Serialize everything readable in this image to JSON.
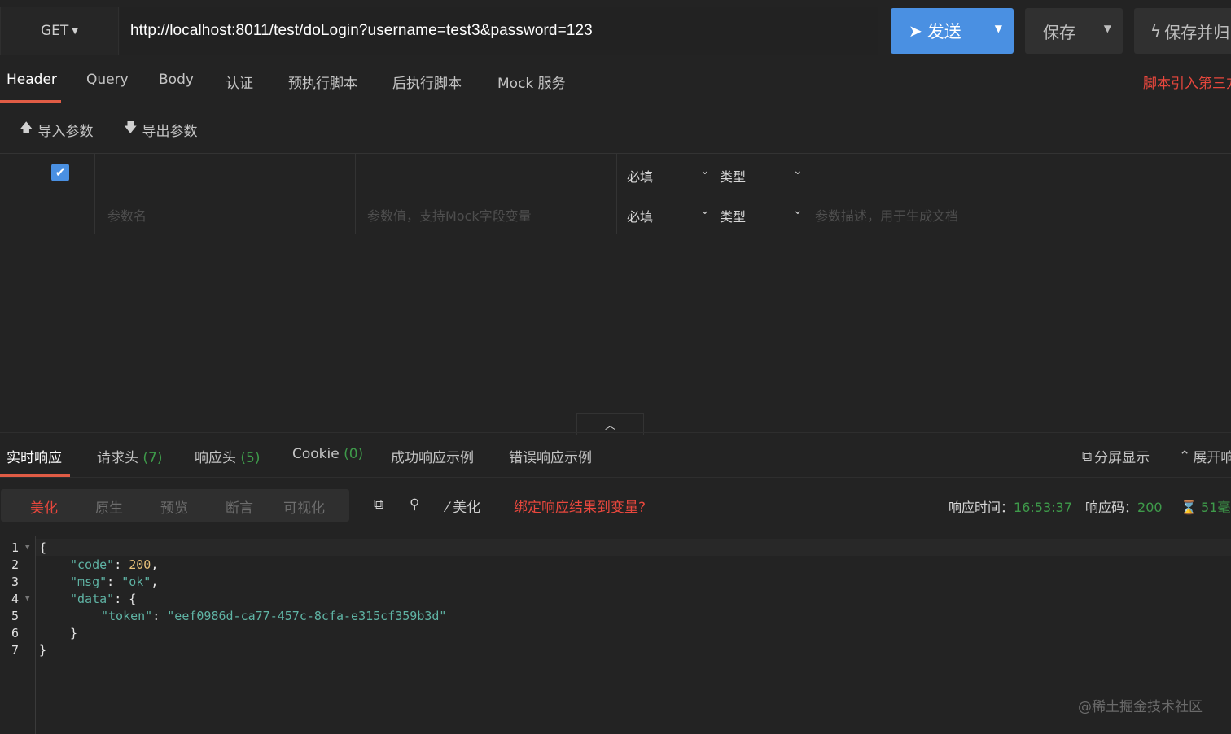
{
  "request": {
    "method": "GET",
    "url": "http://localhost:8011/test/doLogin?username=test3&password=123",
    "send_label": "发送",
    "save_label": "保存",
    "save_return_label": "保存并归"
  },
  "request_tabs": [
    "Header",
    "Query",
    "Body",
    "认证",
    "预执行脚本",
    "后执行脚本",
    "Mock 服务"
  ],
  "script_link": "脚本引入第三方",
  "io": {
    "import": "导入参数",
    "export": "导出参数"
  },
  "params": {
    "row1": {
      "required": "必填",
      "type": "类型"
    },
    "row2": {
      "name_placeholder": "参数名",
      "value_placeholder": "参数值，支持Mock字段变量",
      "required": "必填",
      "type": "类型",
      "desc_placeholder": "参数描述，用于生成文档"
    }
  },
  "response_tabs": [
    {
      "label": "实时响应",
      "count": ""
    },
    {
      "label": "请求头",
      "count": "(7)"
    },
    {
      "label": "响应头",
      "count": "(5)"
    },
    {
      "label": "Cookie",
      "count": "(0)"
    },
    {
      "label": "成功响应示例",
      "count": ""
    },
    {
      "label": "错误响应示例",
      "count": ""
    }
  ],
  "response_right": {
    "split": "分屏显示",
    "expand": "展开响"
  },
  "view_modes": [
    "美化",
    "原生",
    "预览",
    "断言",
    "可视化"
  ],
  "toolbar": {
    "beautify": "美化",
    "bind": "绑定响应结果到变量?"
  },
  "metrics": {
    "time_label": "响应时间：",
    "time_value": "16:53:37",
    "code_label": "响应码：",
    "code_value": "200",
    "duration_value": "51毫"
  },
  "code_lines": [
    "1",
    "2",
    "3",
    "4",
    "5",
    "6",
    "7"
  ],
  "response_json": {
    "code_key": "\"code\"",
    "code_val": "200",
    "msg_key": "\"msg\"",
    "msg_val": "\"ok\"",
    "data_key": "\"data\"",
    "token_key": "\"token\"",
    "token_val": "\"eef0986d-ca77-457c-8cfa-e315cf359b3d\""
  },
  "watermark": "@稀土掘金技术社区",
  "colors": {
    "accent": "#4a90e2",
    "danger": "#e8473d",
    "success": "#3e9a4a",
    "background": "#232323"
  }
}
